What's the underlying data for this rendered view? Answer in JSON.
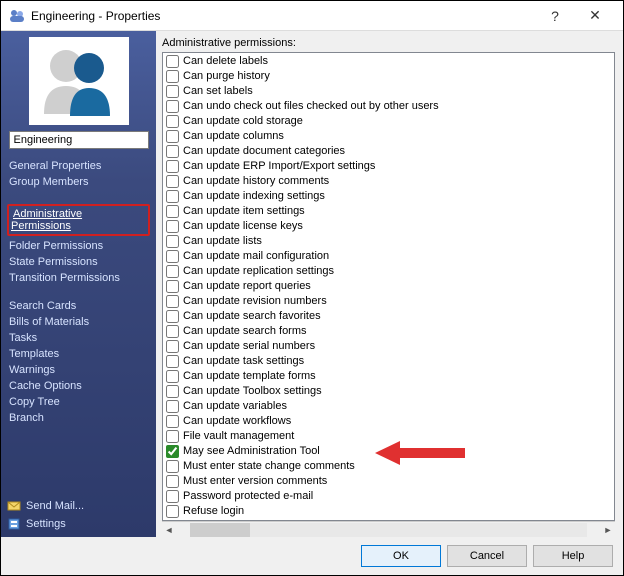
{
  "title": "Engineering - Properties",
  "group_name": "Engineering",
  "sidebar": {
    "nav1": [
      {
        "label": "General Properties"
      },
      {
        "label": "Group Members"
      }
    ],
    "nav2": [
      {
        "label": "Administrative Permissions",
        "selected": true,
        "highlight": true
      },
      {
        "label": "Folder Permissions"
      },
      {
        "label": "State Permissions"
      },
      {
        "label": "Transition Permissions"
      }
    ],
    "nav3": [
      {
        "label": "Search Cards"
      },
      {
        "label": "Bills of Materials"
      },
      {
        "label": "Tasks"
      },
      {
        "label": "Templates"
      },
      {
        "label": "Warnings"
      },
      {
        "label": "Cache Options"
      },
      {
        "label": "Copy Tree"
      },
      {
        "label": "Branch"
      }
    ],
    "send_mail": "Send Mail...",
    "settings": "Settings"
  },
  "main": {
    "section_label": "Administrative permissions:",
    "permissions": [
      {
        "label": "Can delete labels",
        "checked": false
      },
      {
        "label": "Can purge history",
        "checked": false
      },
      {
        "label": "Can set labels",
        "checked": false
      },
      {
        "label": "Can undo check out files checked out by other users",
        "checked": false
      },
      {
        "label": "Can update cold storage",
        "checked": false
      },
      {
        "label": "Can update columns",
        "checked": false
      },
      {
        "label": "Can update document categories",
        "checked": false
      },
      {
        "label": "Can update ERP Import/Export settings",
        "checked": false
      },
      {
        "label": "Can update history comments",
        "checked": false
      },
      {
        "label": "Can update indexing settings",
        "checked": false
      },
      {
        "label": "Can update item settings",
        "checked": false
      },
      {
        "label": "Can update license keys",
        "checked": false
      },
      {
        "label": "Can update lists",
        "checked": false
      },
      {
        "label": "Can update mail configuration",
        "checked": false
      },
      {
        "label": "Can update replication settings",
        "checked": false
      },
      {
        "label": "Can update report queries",
        "checked": false
      },
      {
        "label": "Can update revision numbers",
        "checked": false
      },
      {
        "label": "Can update search favorites",
        "checked": false
      },
      {
        "label": "Can update search forms",
        "checked": false
      },
      {
        "label": "Can update serial numbers",
        "checked": false
      },
      {
        "label": "Can update task settings",
        "checked": false
      },
      {
        "label": "Can update template forms",
        "checked": false
      },
      {
        "label": "Can update Toolbox settings",
        "checked": false
      },
      {
        "label": "Can update variables",
        "checked": false
      },
      {
        "label": "Can update workflows",
        "checked": false
      },
      {
        "label": "File vault management",
        "checked": false
      },
      {
        "label": "May see Administration Tool",
        "checked": true,
        "highlight": true
      },
      {
        "label": "Must enter state change comments",
        "checked": false
      },
      {
        "label": "Must enter version comments",
        "checked": false
      },
      {
        "label": "Password protected e-mail",
        "checked": false
      },
      {
        "label": "Refuse login",
        "checked": false
      }
    ]
  },
  "footer": {
    "ok": "OK",
    "cancel": "Cancel",
    "help": "Help"
  }
}
